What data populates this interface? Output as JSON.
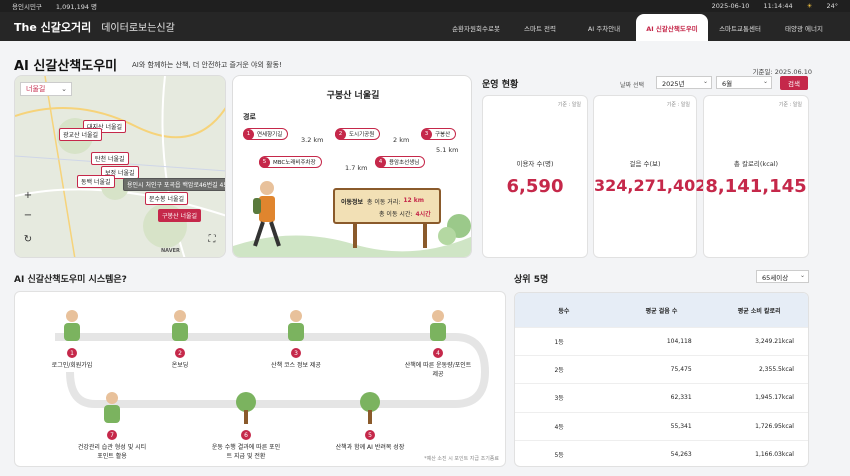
{
  "topbar": {
    "district": "용인시민구",
    "population": "1,091,194 명",
    "date": "2025-06-10",
    "time": "11:14:44",
    "weather_icon": "sun-icon",
    "temperature": "24°"
  },
  "header": {
    "brand": "The 신갈오거리",
    "brand_sub": "데이터로보는신갈"
  },
  "nav": {
    "tabs": [
      "순환자원회수로봇",
      "스마트 전력",
      "AI 주차안내",
      "AI 신갈산책도우미",
      "스마트교통센터",
      "태양광 에너지"
    ],
    "active": "AI 신갈산책도우미"
  },
  "page": {
    "title": "AI 신갈산책도우미",
    "subtitle": "AI와 함께하는 산책, 더 안전하고 즐거운 야외 활동!",
    "base_date": "기준일: 2025.06.10"
  },
  "map": {
    "select": "너울길",
    "labels": [
      "대지산 너울길",
      "광교산 너울길",
      "탄천 너울길",
      "보정 너울길",
      "동백 너울길",
      "용인시 처인구 포곡읍 백암로46번길 45",
      "문수봉 너울길",
      "구봉산 너울길"
    ],
    "provider": "NAVER"
  },
  "route": {
    "title": "구봉산 너울길",
    "section_label": "경로",
    "stops": [
      "연세향기길",
      "도시기공원",
      "구봉산",
      "용암초선생님",
      "MBC노래비주차장"
    ],
    "distances": [
      "3.2 km",
      "2 km",
      "5.1 km",
      "1.7 km"
    ],
    "sign": {
      "label": "이동정보",
      "distance_key": "총 이동 거리:",
      "distance_val": "12 km",
      "time_key": "총 이동 시간:",
      "time_val": "4시간"
    }
  },
  "ops": {
    "title": "운영 현황",
    "year_label": "날짜 선택",
    "year": "2025년",
    "month": "6월",
    "search_button": "검색",
    "stats": [
      {
        "basis": "기준 : 일일",
        "label": "이용자 수(명)",
        "value": "6,590"
      },
      {
        "basis": "기준 : 일일",
        "label": "걸음 수(보)",
        "value": "324,271,402"
      },
      {
        "basis": "기준 : 일일",
        "label": "총 칼로리(kcal)",
        "value": "8,141,145"
      }
    ]
  },
  "system": {
    "title": "AI 신갈산책도우미 시스템은?",
    "steps": [
      {
        "n": "1",
        "text": "로그인/회원가입"
      },
      {
        "n": "2",
        "text": "온보딩"
      },
      {
        "n": "3",
        "text": "산책 코스 정보 제공"
      },
      {
        "n": "4",
        "text": "산책에 따른 운동량/포인트 제공"
      },
      {
        "n": "5",
        "text": "산책과 함께 AI 반려목 성장"
      },
      {
        "n": "6",
        "text": "운동 수행 결과에 따른 포인트 지급 및 전환"
      },
      {
        "n": "7",
        "text": "건강관리 습관 형성 및 시티포인트 활용"
      }
    ],
    "note": "*예산 소진 시 포인트 지급 조기종료"
  },
  "top5": {
    "title": "상위 5명",
    "filter": "65세이상",
    "headers": [
      "등수",
      "평균 걸음 수",
      "평균 소비 칼로리"
    ],
    "rows": [
      [
        "1등",
        "104,118",
        "3,249.21kcal"
      ],
      [
        "2등",
        "75,475",
        "2,355.5kcal"
      ],
      [
        "3등",
        "62,331",
        "1,945.17kcal"
      ],
      [
        "4등",
        "55,341",
        "1,726.95kcal"
      ],
      [
        "5등",
        "54,263",
        "1,166.03kcal"
      ]
    ]
  },
  "colors": {
    "accent": "#c5284a",
    "dark": "#262626"
  }
}
